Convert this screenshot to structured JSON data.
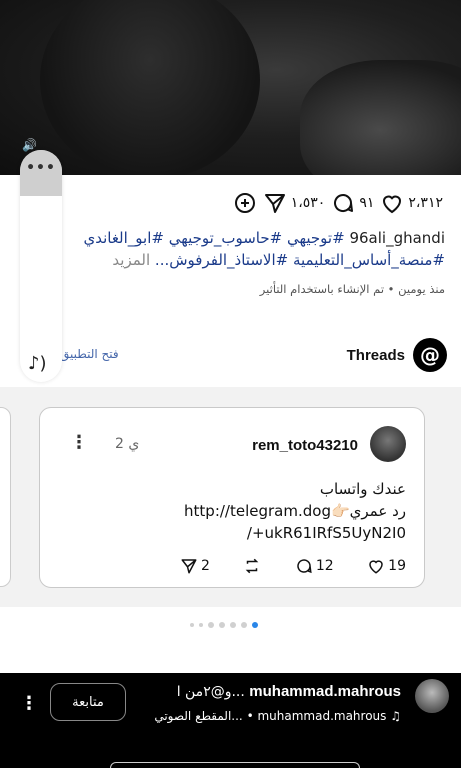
{
  "actions": {
    "likes": "٢،٣١٢",
    "comments": "٩١",
    "shares": "١،٥٣٠"
  },
  "caption": {
    "username": "96ali_ghandi",
    "line1": "#توجيهي #حاسوب_توجيهي #ابو_الغاندي",
    "line2": "#منصة_أساس_التعليمية #الاستاذ_الفرفوش...",
    "more": "المزيد",
    "meta_time": "منذ يومين",
    "meta_effect": "تم الإنشاء باستخدام التأثير"
  },
  "threads": {
    "label": "Threads",
    "open_app": "فتح التطبيق"
  },
  "post": {
    "username": "rem_toto43210",
    "time": "2 ي",
    "text_line1": "عندك واتساب",
    "text_line2": "رد عمري👉🏻http://telegram.dog",
    "text_line3": "/+ukR61IRfS5UyN2I0",
    "likes": "19",
    "replies": "12",
    "shares": "2"
  },
  "bottom": {
    "username": "muhammad.mahrous",
    "title_suffix": "و@٢من ا...",
    "follow_label": "متابعة",
    "audio_label": "المقطع الصوتي...",
    "audio_user": "muhammad.mahrous"
  },
  "colors": {
    "hashtag": "#1b3b8a",
    "active_dot": "#2a86e8"
  }
}
